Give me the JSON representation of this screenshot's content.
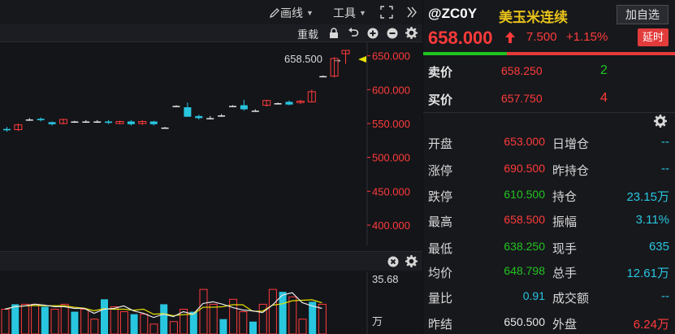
{
  "toolbar": {
    "draw_label": "画线",
    "tools_label": "工具",
    "reload_label": "重载"
  },
  "price_axis": {
    "ticks": [
      "650.000",
      "600.000",
      "550.000",
      "500.000",
      "450.000",
      "400.000"
    ],
    "last_price_label": "658.500"
  },
  "volume_axis": {
    "top_label": "35.68",
    "unit_label": "万"
  },
  "quote": {
    "symbol": "@ZC0Y",
    "name": "美玉米连续",
    "add_watch_label": "加自选",
    "price": "658.000",
    "change": "7.500",
    "change_pct": "+1.15%",
    "delay_label": "延时",
    "sell": {
      "label": "卖价",
      "price": "658.250",
      "volume": "2"
    },
    "buy": {
      "label": "买价",
      "price": "657.750",
      "volume": "4"
    }
  },
  "stats": [
    {
      "l1": "开盘",
      "v1": "653.000",
      "c1": "red",
      "l2": "日增仓",
      "v2": "--",
      "c2": "cyan"
    },
    {
      "l1": "涨停",
      "v1": "690.500",
      "c1": "red",
      "l2": "昨持仓",
      "v2": "--",
      "c2": "cyan"
    },
    {
      "l1": "跌停",
      "v1": "610.500",
      "c1": "green",
      "l2": "持仓",
      "v2": "23.15万",
      "c2": "cyan"
    },
    {
      "l1": "最高",
      "v1": "658.500",
      "c1": "red",
      "l2": "振幅",
      "v2": "3.11%",
      "c2": "cyan"
    },
    {
      "l1": "最低",
      "v1": "638.250",
      "c1": "green",
      "l2": "现手",
      "v2": "635",
      "c2": "cyan"
    },
    {
      "l1": "均价",
      "v1": "648.798",
      "c1": "green",
      "l2": "总手",
      "v2": "12.61万",
      "c2": "cyan"
    },
    {
      "l1": "量比",
      "v1": "0.91",
      "c1": "cyan",
      "l2": "成交额",
      "v2": "--",
      "c2": "cyan"
    },
    {
      "l1": "昨结",
      "v1": "650.500",
      "c1": "white",
      "l2": "外盘",
      "v2": "6.24万",
      "c2": "red"
    }
  ],
  "chart_data": {
    "type": "candlestick",
    "ylim": [
      370,
      670
    ],
    "candles": [
      {
        "o": 542,
        "c": 540,
        "h": 545,
        "l": 538
      },
      {
        "o": 541,
        "c": 548,
        "h": 550,
        "l": 539
      },
      {
        "o": 556,
        "c": 556,
        "h": 558,
        "l": 554
      },
      {
        "o": 557,
        "c": 555,
        "h": 559,
        "l": 553
      },
      {
        "o": 552,
        "c": 549,
        "h": 553,
        "l": 547
      },
      {
        "o": 550,
        "c": 556,
        "h": 557,
        "l": 549
      },
      {
        "o": 553,
        "c": 553,
        "h": 554,
        "l": 551
      },
      {
        "o": 553,
        "c": 553,
        "h": 555,
        "l": 551
      },
      {
        "o": 553,
        "c": 553,
        "h": 555,
        "l": 551
      },
      {
        "o": 553,
        "c": 551,
        "h": 555,
        "l": 549
      },
      {
        "o": 550,
        "c": 553,
        "h": 554,
        "l": 549
      },
      {
        "o": 553,
        "c": 549,
        "h": 555,
        "l": 547
      },
      {
        "o": 550,
        "c": 553,
        "h": 555,
        "l": 548
      },
      {
        "o": 553,
        "c": 549,
        "h": 554,
        "l": 547
      },
      {
        "o": 544,
        "c": 544,
        "h": 545,
        "l": 543
      },
      {
        "o": 576,
        "c": 576,
        "h": 577,
        "l": 575
      },
      {
        "o": 574,
        "c": 560,
        "h": 581,
        "l": 560
      },
      {
        "o": 561,
        "c": 558,
        "h": 563,
        "l": 556
      },
      {
        "o": 558,
        "c": 558,
        "h": 561,
        "l": 557
      },
      {
        "o": 562,
        "c": 562,
        "h": 564,
        "l": 560
      },
      {
        "o": 576,
        "c": 576,
        "h": 577,
        "l": 575
      },
      {
        "o": 577,
        "c": 571,
        "h": 585,
        "l": 569
      },
      {
        "o": 569,
        "c": 569,
        "h": 571,
        "l": 568
      },
      {
        "o": 577,
        "c": 584,
        "h": 585,
        "l": 575
      },
      {
        "o": 580,
        "c": 580,
        "h": 581,
        "l": 578
      },
      {
        "o": 582,
        "c": 578,
        "h": 584,
        "l": 577
      },
      {
        "o": 581,
        "c": 583,
        "h": 585,
        "l": 579
      },
      {
        "o": 582,
        "c": 597,
        "h": 600,
        "l": 581
      },
      {
        "o": 620,
        "c": 620,
        "h": 621,
        "l": 619
      },
      {
        "o": 620,
        "c": 646,
        "h": 648,
        "l": 618
      },
      {
        "o": 653,
        "c": 658,
        "h": 658.5,
        "l": 638.25
      }
    ],
    "volumes": [
      10,
      12,
      12,
      12,
      11,
      10,
      12,
      9,
      10,
      6,
      14,
      11,
      9,
      8,
      8,
      4,
      12,
      5,
      10,
      9,
      18,
      12,
      6,
      14,
      9,
      5,
      12,
      18,
      17,
      15,
      6,
      13,
      12
    ]
  }
}
